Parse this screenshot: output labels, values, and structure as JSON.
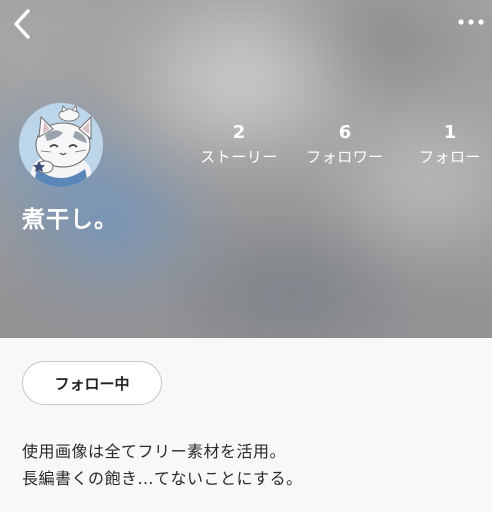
{
  "profile": {
    "username": "煮干し。",
    "stats": [
      {
        "value": "2",
        "label": "ストーリー"
      },
      {
        "value": "6",
        "label": "フォロワー"
      },
      {
        "value": "1",
        "label": "フォロー"
      }
    ],
    "follow_button_label": "フォロー中",
    "bio_lines": [
      "使用画像は全てフリー素材を活用。",
      "長編書くの飽き…てないことにする。"
    ]
  },
  "icons": {
    "back": "chevron-left-icon",
    "more": "more-horizontal-icon",
    "avatar": "cat-avatar"
  },
  "colors": {
    "header_text": "#ffffff",
    "page_background": "#f8f8f8",
    "avatar_background": "#bcd5e8"
  }
}
